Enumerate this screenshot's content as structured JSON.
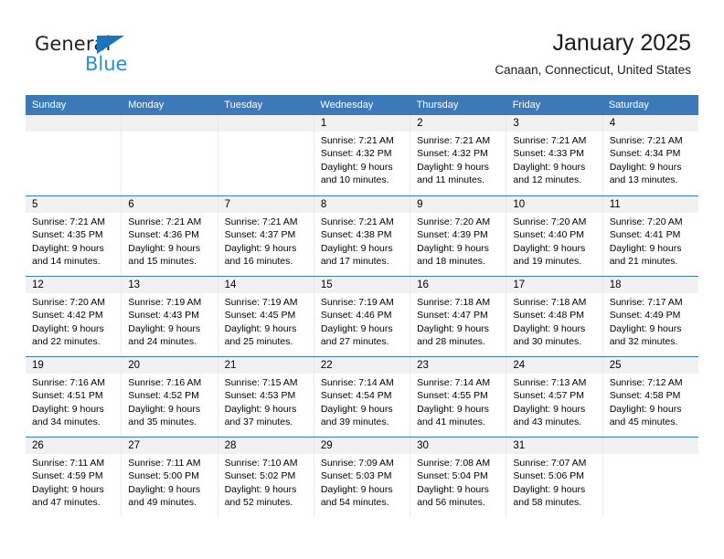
{
  "brand": {
    "name_top": "General",
    "name_bottom": "Blue",
    "triangle_icon": "triangle-icon",
    "colors": {
      "general_text": "#231f20",
      "blue_text": "#2a8fd4",
      "triangle": "#1b75bb"
    }
  },
  "header": {
    "title": "January 2025",
    "subtitle": "Canaan, Connecticut, United States"
  },
  "theme": {
    "header_row_bg": "#3b79b8",
    "day_band_bg": "#f1f1f1",
    "week_divider": "#3b79b8",
    "cell_divider": "#e9e9e9"
  },
  "weekdays": [
    "Sunday",
    "Monday",
    "Tuesday",
    "Wednesday",
    "Thursday",
    "Friday",
    "Saturday"
  ],
  "weeks": [
    [
      {
        "day": "",
        "empty": true,
        "lines": []
      },
      {
        "day": "",
        "empty": true,
        "lines": []
      },
      {
        "day": "",
        "empty": true,
        "lines": []
      },
      {
        "day": "1",
        "empty": false,
        "lines": [
          "Sunrise: 7:21 AM",
          "Sunset: 4:32 PM",
          "Daylight: 9 hours",
          "and 10 minutes."
        ]
      },
      {
        "day": "2",
        "empty": false,
        "lines": [
          "Sunrise: 7:21 AM",
          "Sunset: 4:32 PM",
          "Daylight: 9 hours",
          "and 11 minutes."
        ]
      },
      {
        "day": "3",
        "empty": false,
        "lines": [
          "Sunrise: 7:21 AM",
          "Sunset: 4:33 PM",
          "Daylight: 9 hours",
          "and 12 minutes."
        ]
      },
      {
        "day": "4",
        "empty": false,
        "lines": [
          "Sunrise: 7:21 AM",
          "Sunset: 4:34 PM",
          "Daylight: 9 hours",
          "and 13 minutes."
        ]
      }
    ],
    [
      {
        "day": "5",
        "empty": false,
        "lines": [
          "Sunrise: 7:21 AM",
          "Sunset: 4:35 PM",
          "Daylight: 9 hours",
          "and 14 minutes."
        ]
      },
      {
        "day": "6",
        "empty": false,
        "lines": [
          "Sunrise: 7:21 AM",
          "Sunset: 4:36 PM",
          "Daylight: 9 hours",
          "and 15 minutes."
        ]
      },
      {
        "day": "7",
        "empty": false,
        "lines": [
          "Sunrise: 7:21 AM",
          "Sunset: 4:37 PM",
          "Daylight: 9 hours",
          "and 16 minutes."
        ]
      },
      {
        "day": "8",
        "empty": false,
        "lines": [
          "Sunrise: 7:21 AM",
          "Sunset: 4:38 PM",
          "Daylight: 9 hours",
          "and 17 minutes."
        ]
      },
      {
        "day": "9",
        "empty": false,
        "lines": [
          "Sunrise: 7:20 AM",
          "Sunset: 4:39 PM",
          "Daylight: 9 hours",
          "and 18 minutes."
        ]
      },
      {
        "day": "10",
        "empty": false,
        "lines": [
          "Sunrise: 7:20 AM",
          "Sunset: 4:40 PM",
          "Daylight: 9 hours",
          "and 19 minutes."
        ]
      },
      {
        "day": "11",
        "empty": false,
        "lines": [
          "Sunrise: 7:20 AM",
          "Sunset: 4:41 PM",
          "Daylight: 9 hours",
          "and 21 minutes."
        ]
      }
    ],
    [
      {
        "day": "12",
        "empty": false,
        "lines": [
          "Sunrise: 7:20 AM",
          "Sunset: 4:42 PM",
          "Daylight: 9 hours",
          "and 22 minutes."
        ]
      },
      {
        "day": "13",
        "empty": false,
        "lines": [
          "Sunrise: 7:19 AM",
          "Sunset: 4:43 PM",
          "Daylight: 9 hours",
          "and 24 minutes."
        ]
      },
      {
        "day": "14",
        "empty": false,
        "lines": [
          "Sunrise: 7:19 AM",
          "Sunset: 4:45 PM",
          "Daylight: 9 hours",
          "and 25 minutes."
        ]
      },
      {
        "day": "15",
        "empty": false,
        "lines": [
          "Sunrise: 7:19 AM",
          "Sunset: 4:46 PM",
          "Daylight: 9 hours",
          "and 27 minutes."
        ]
      },
      {
        "day": "16",
        "empty": false,
        "lines": [
          "Sunrise: 7:18 AM",
          "Sunset: 4:47 PM",
          "Daylight: 9 hours",
          "and 28 minutes."
        ]
      },
      {
        "day": "17",
        "empty": false,
        "lines": [
          "Sunrise: 7:18 AM",
          "Sunset: 4:48 PM",
          "Daylight: 9 hours",
          "and 30 minutes."
        ]
      },
      {
        "day": "18",
        "empty": false,
        "lines": [
          "Sunrise: 7:17 AM",
          "Sunset: 4:49 PM",
          "Daylight: 9 hours",
          "and 32 minutes."
        ]
      }
    ],
    [
      {
        "day": "19",
        "empty": false,
        "lines": [
          "Sunrise: 7:16 AM",
          "Sunset: 4:51 PM",
          "Daylight: 9 hours",
          "and 34 minutes."
        ]
      },
      {
        "day": "20",
        "empty": false,
        "lines": [
          "Sunrise: 7:16 AM",
          "Sunset: 4:52 PM",
          "Daylight: 9 hours",
          "and 35 minutes."
        ]
      },
      {
        "day": "21",
        "empty": false,
        "lines": [
          "Sunrise: 7:15 AM",
          "Sunset: 4:53 PM",
          "Daylight: 9 hours",
          "and 37 minutes."
        ]
      },
      {
        "day": "22",
        "empty": false,
        "lines": [
          "Sunrise: 7:14 AM",
          "Sunset: 4:54 PM",
          "Daylight: 9 hours",
          "and 39 minutes."
        ]
      },
      {
        "day": "23",
        "empty": false,
        "lines": [
          "Sunrise: 7:14 AM",
          "Sunset: 4:55 PM",
          "Daylight: 9 hours",
          "and 41 minutes."
        ]
      },
      {
        "day": "24",
        "empty": false,
        "lines": [
          "Sunrise: 7:13 AM",
          "Sunset: 4:57 PM",
          "Daylight: 9 hours",
          "and 43 minutes."
        ]
      },
      {
        "day": "25",
        "empty": false,
        "lines": [
          "Sunrise: 7:12 AM",
          "Sunset: 4:58 PM",
          "Daylight: 9 hours",
          "and 45 minutes."
        ]
      }
    ],
    [
      {
        "day": "26",
        "empty": false,
        "lines": [
          "Sunrise: 7:11 AM",
          "Sunset: 4:59 PM",
          "Daylight: 9 hours",
          "and 47 minutes."
        ]
      },
      {
        "day": "27",
        "empty": false,
        "lines": [
          "Sunrise: 7:11 AM",
          "Sunset: 5:00 PM",
          "Daylight: 9 hours",
          "and 49 minutes."
        ]
      },
      {
        "day": "28",
        "empty": false,
        "lines": [
          "Sunrise: 7:10 AM",
          "Sunset: 5:02 PM",
          "Daylight: 9 hours",
          "and 52 minutes."
        ]
      },
      {
        "day": "29",
        "empty": false,
        "lines": [
          "Sunrise: 7:09 AM",
          "Sunset: 5:03 PM",
          "Daylight: 9 hours",
          "and 54 minutes."
        ]
      },
      {
        "day": "30",
        "empty": false,
        "lines": [
          "Sunrise: 7:08 AM",
          "Sunset: 5:04 PM",
          "Daylight: 9 hours",
          "and 56 minutes."
        ]
      },
      {
        "day": "31",
        "empty": false,
        "lines": [
          "Sunrise: 7:07 AM",
          "Sunset: 5:06 PM",
          "Daylight: 9 hours",
          "and 58 minutes."
        ]
      },
      {
        "day": "",
        "empty": true,
        "lines": []
      }
    ]
  ]
}
